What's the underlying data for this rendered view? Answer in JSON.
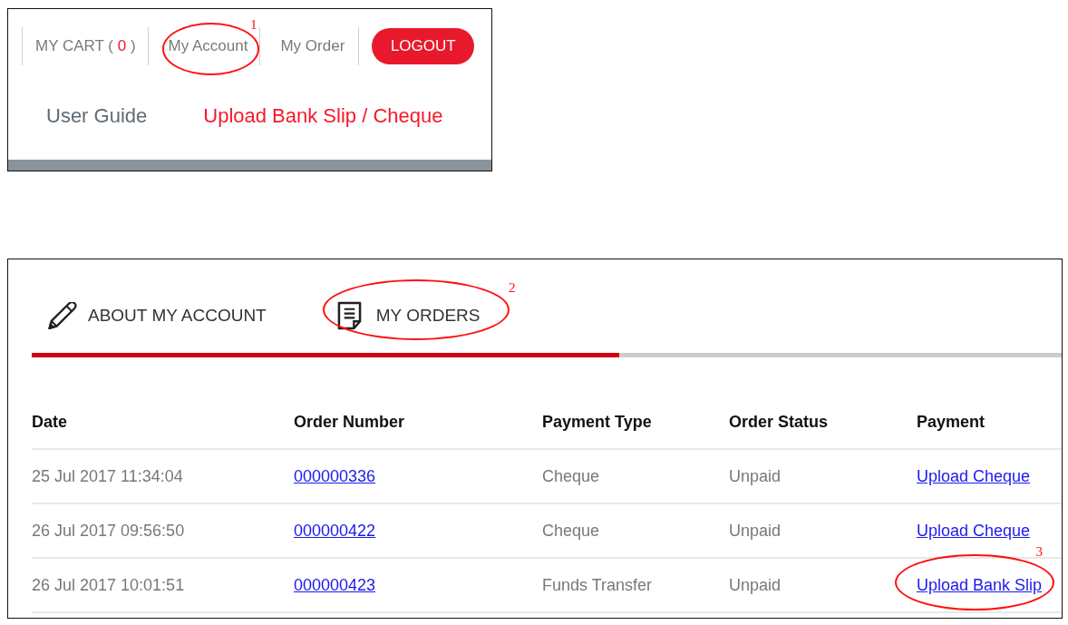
{
  "header": {
    "cart": {
      "label": "MY CART (",
      "count": "0",
      "close": ")"
    },
    "nav_links": [
      {
        "label": "My Account",
        "callout": "1"
      },
      {
        "label": "My Order"
      }
    ],
    "logout_button": "LOGOUT",
    "links": [
      {
        "label": "User Guide",
        "kind": "normal"
      },
      {
        "label": "Upload Bank Slip / Cheque",
        "kind": "accent"
      }
    ]
  },
  "account": {
    "tabs": [
      {
        "label": "ABOUT MY ACCOUNT"
      },
      {
        "label": "MY ORDERS",
        "callout": "2"
      }
    ],
    "tab_indicator": {
      "level": 0.57
    },
    "table": {
      "columns": [
        "Date",
        "Order Number",
        "Payment Type",
        "Order Status",
        "Payment"
      ],
      "rows": [
        {
          "date": "25 Jul 2017 11:34:04",
          "order_number": "000000336",
          "payment_type": "Cheque",
          "status": "Unpaid",
          "payment": "Upload Cheque"
        },
        {
          "date": "26 Jul 2017 09:56:50",
          "order_number": "000000422",
          "payment_type": "Cheque",
          "status": "Unpaid",
          "payment": "Upload Cheque"
        },
        {
          "date": "26 Jul 2017 10:01:51",
          "order_number": "000000423",
          "payment_type": "Funds Transfer",
          "status": "Unpaid",
          "payment": "Upload Bank Slip",
          "callout": "3"
        }
      ]
    }
  }
}
